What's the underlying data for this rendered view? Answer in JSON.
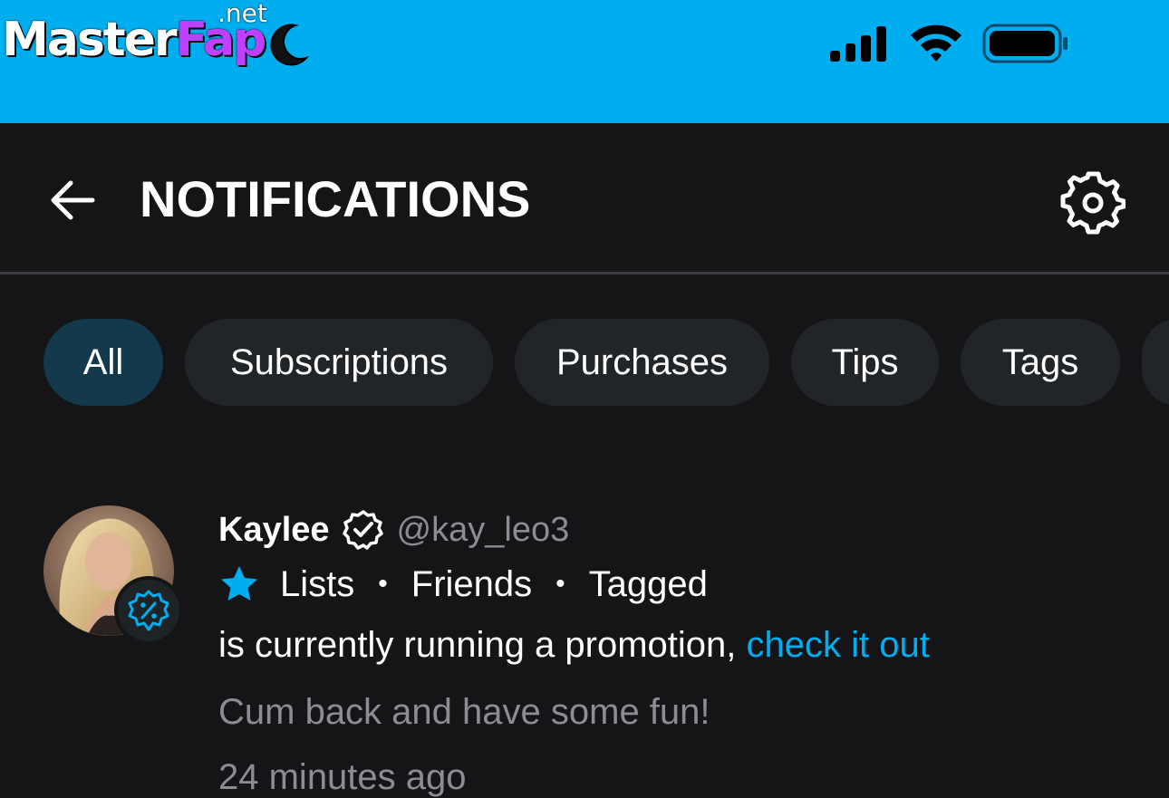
{
  "watermark": {
    "main": "Master",
    "accent": "Fap",
    "suffix": ".net"
  },
  "header": {
    "title": "NOTIFICATIONS"
  },
  "tabs": [
    {
      "label": "All",
      "active": true
    },
    {
      "label": "Subscriptions",
      "active": false
    },
    {
      "label": "Purchases",
      "active": false
    },
    {
      "label": "Tips",
      "active": false
    },
    {
      "label": "Tags",
      "active": false
    }
  ],
  "notification": {
    "name": "Kaylee",
    "handle": "@kay_leo3",
    "lists": [
      "Lists",
      "Friends",
      "Tagged"
    ],
    "separator": "•",
    "message": "is currently running a promotion,",
    "link_text": "check it out",
    "promo_text": "Cum back and have some fun!",
    "time": "24 minutes ago"
  },
  "colors": {
    "status_bar": "#00aeef",
    "background": "#151517",
    "accent_link": "#00aeef",
    "tab_active": "#12394c",
    "tab_inactive": "#222527",
    "muted_text": "#8a8d93"
  },
  "icons": [
    "back-arrow-icon",
    "gear-icon",
    "signal-icon",
    "wifi-icon",
    "battery-icon",
    "verified-icon",
    "star-icon",
    "promo-percent-icon"
  ]
}
